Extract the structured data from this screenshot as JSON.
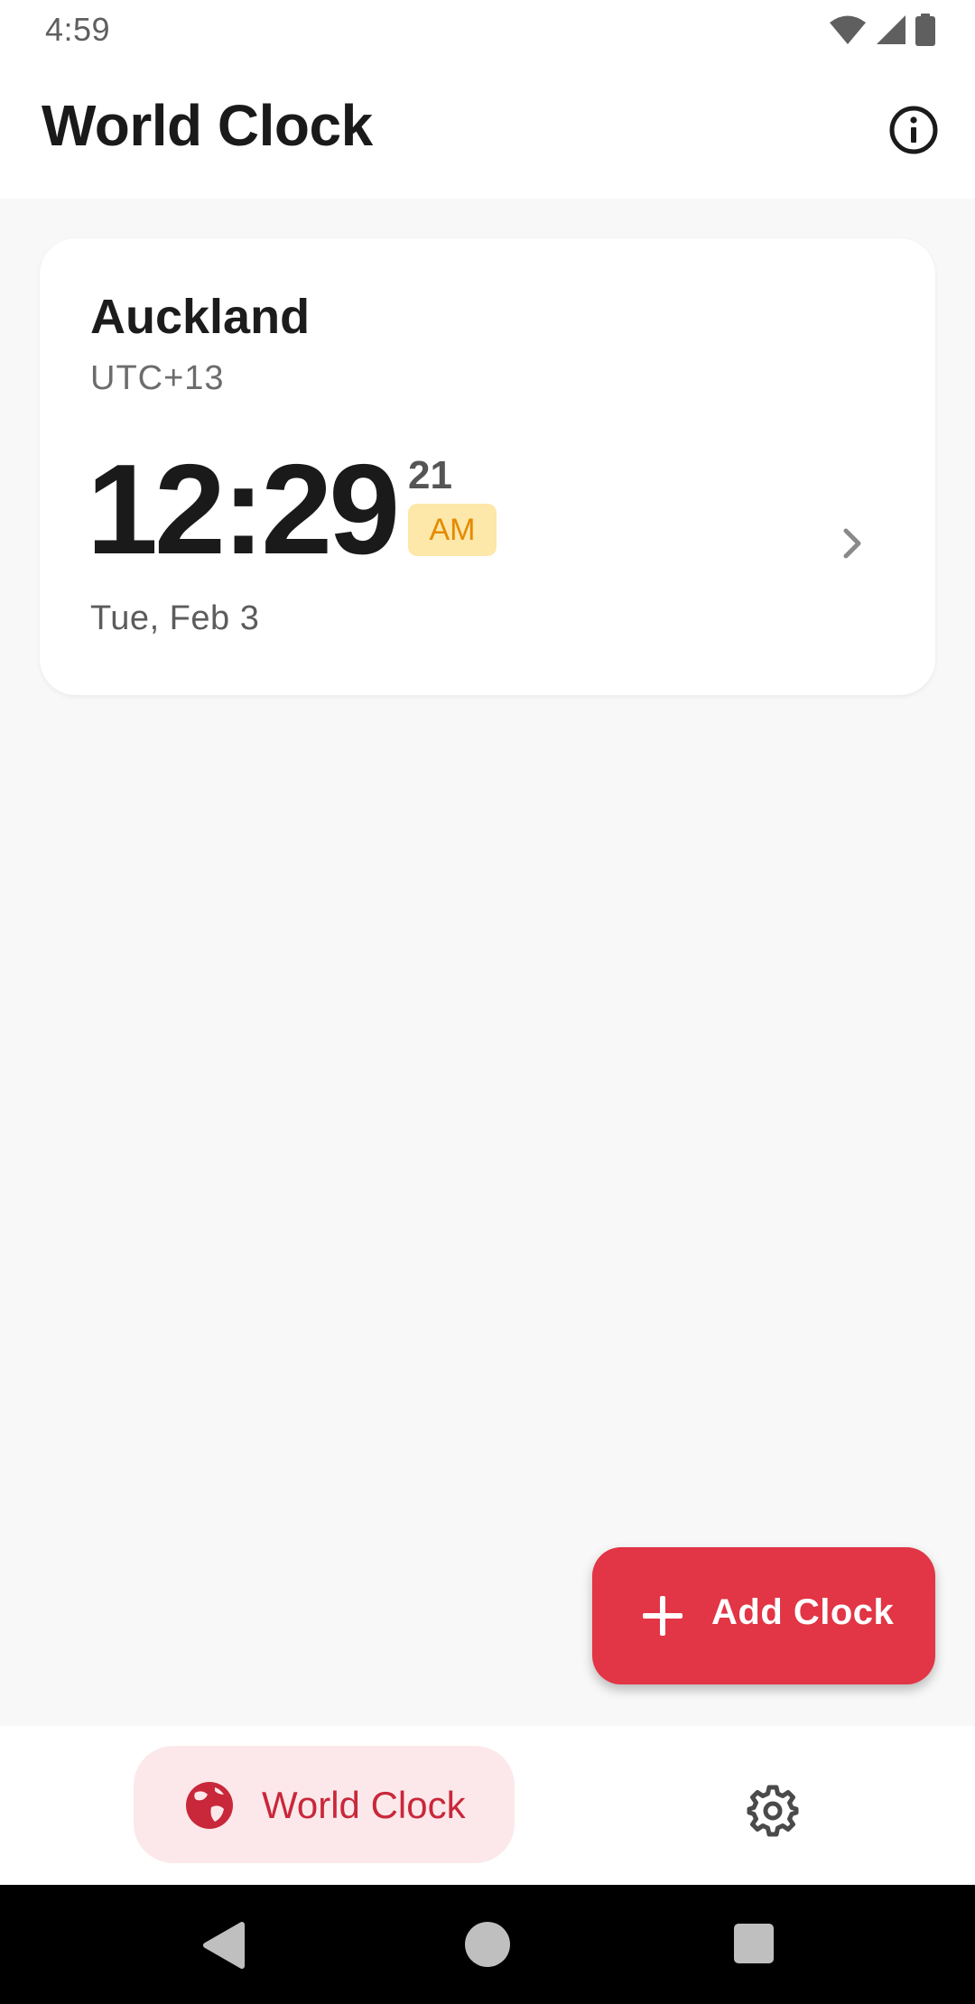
{
  "status_bar": {
    "time": "4:59",
    "icons": [
      "wifi-icon",
      "cellular-signal-icon",
      "battery-icon"
    ]
  },
  "app_bar": {
    "title": "World Clock",
    "action_icon": "info-icon"
  },
  "clock_card": {
    "city": "Auckland",
    "utc_offset": "UTC+13",
    "time": "12:29",
    "seconds": "21",
    "ampm": "AM",
    "date": "Tue, Feb 3",
    "trailing_icon": "chevron-right-icon"
  },
  "fab": {
    "label": "Add Clock",
    "icon": "plus-icon"
  },
  "bottom_nav": {
    "items": [
      {
        "label": "World Clock",
        "icon": "globe-icon",
        "selected": true
      },
      {
        "label": "",
        "icon": "gear-icon",
        "selected": false
      }
    ]
  },
  "system_nav": {
    "buttons": [
      "back-icon",
      "home-icon",
      "recents-icon"
    ]
  },
  "colors": {
    "accent": "#e23545",
    "nav_selected_bg": "#fce8ea",
    "nav_selected_fg": "#c9273a",
    "ampm_bg": "#fde7a9",
    "ampm_fg": "#e58a00",
    "background": "#f8f8f8"
  }
}
